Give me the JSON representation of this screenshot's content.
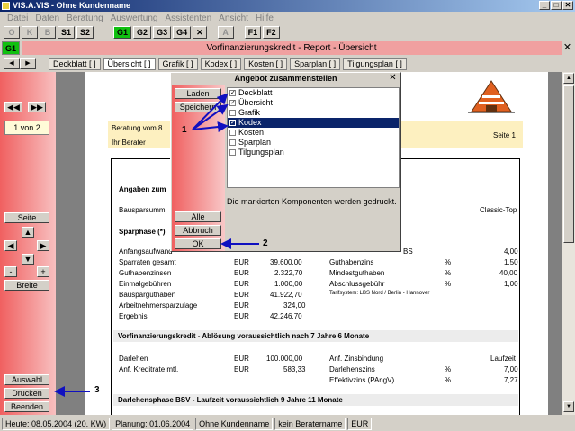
{
  "window": {
    "title": "VIS.A.VIS - Ohne Kundenname"
  },
  "menu": [
    "Datei",
    "Daten",
    "Beratung",
    "Auswertung",
    "Assistenten",
    "Ansicht",
    "Hilfe"
  ],
  "toolbar": {
    "o": "O",
    "k": "K",
    "b": "B",
    "s1": "S1",
    "s2": "S2",
    "g1": "G1",
    "g2": "G2",
    "g3": "G3",
    "g4": "G4",
    "x": "✕",
    "a": "A",
    "f1": "F1",
    "f2": "F2"
  },
  "header": {
    "badge": "G1",
    "title": "Vorfinanzierungskredit - Report - Übersicht",
    "close": "✕"
  },
  "tabs": [
    "Deckblatt [ ]",
    "Übersicht [ ]",
    "Grafik [ ]",
    "Kodex [ ]",
    "Kosten [ ]",
    "Sparplan [ ]",
    "Tilgungsplan [ ]"
  ],
  "left": {
    "page_indicator": "1 von 2",
    "seite": "Seite",
    "minus": "-",
    "plus": "+",
    "breite": "Breite",
    "auswahl": "Auswahl",
    "drucken": "Drucken",
    "beenden": "Beenden"
  },
  "doc": {
    "beratung": "Beratung vom 8.",
    "berater": "Ihr Berater",
    "seite": "Seite  1",
    "angaben": "Angaben zum",
    "bausparsumme": "Bausparsumm",
    "classic": "Classic-Top",
    "sparphase": "Sparphase (*)",
    "sbs": "BS",
    "rows_left": [
      [
        "Anfangsaufwand",
        "",
        ""
      ],
      [
        "Sparraten gesamt",
        "EUR",
        "39.600,00"
      ],
      [
        "Guthabenzinsen",
        "EUR",
        "2.322,70"
      ],
      [
        "Einmalgebühren",
        "EUR",
        "1.000,00"
      ],
      [
        "Bausparguthaben",
        "EUR",
        "41.922,70"
      ],
      [
        "Arbeitnehmersparzulage",
        "EUR",
        "324,00"
      ],
      [
        "Ergebnis",
        "EUR",
        "42.246,70"
      ]
    ],
    "rows_right": [
      [
        "",
        "",
        "4,00"
      ],
      [
        "Guthabenzins",
        "%",
        "1,50"
      ],
      [
        "Mindestguthaben",
        "%",
        "40,00"
      ],
      [
        "Abschlussgebühr",
        "%",
        "1,00"
      ]
    ],
    "tarif": "Tarifsystem: LBS Nord / Berlin - Hannover",
    "vorfin_head": "Vorfinanzierungskredit  -  Ablösung  voraussichtlich nach 7 Jahre 6 Monate",
    "vorfin_left": [
      [
        "Darlehen",
        "EUR",
        "100.000,00"
      ],
      [
        "Anf. Kreditrate mtl.",
        "EUR",
        "583,33"
      ]
    ],
    "vorfin_right": [
      [
        "Anf. Zinsbindung",
        "",
        "Laufzeit"
      ],
      [
        "Darlehenszins",
        "%",
        "7,00"
      ],
      [
        "Effektivzins (PAngV)",
        "%",
        "7,27"
      ]
    ],
    "darlehen_head": "Darlehensphase BSV  -  Laufzeit  voraussichtlich 9 Jahre 11 Monate"
  },
  "dialog": {
    "title": "Angebot zusammenstellen",
    "close": "✕",
    "laden": "Laden",
    "speichern": "Speichern",
    "alle": "Alle",
    "abbruch": "Abbruch",
    "ok": "OK",
    "items": [
      {
        "label": "Deckblatt",
        "check": "✓"
      },
      {
        "label": "Übersicht",
        "check": "✓"
      },
      {
        "label": "Grafik",
        "check": ""
      },
      {
        "label": "Kodex",
        "check": "✓"
      },
      {
        "label": "Kosten",
        "check": ""
      },
      {
        "label": "Sparplan",
        "check": ""
      },
      {
        "label": "Tilgungsplan",
        "check": ""
      }
    ],
    "info": "Die markierten Komponenten werden gedruckt."
  },
  "annotations": {
    "one": "1",
    "two": "2",
    "three": "3"
  },
  "status": [
    "Heute: 08.05.2004 (20. KW)",
    "Planung: 01.06.2004",
    "Ohne Kundenname",
    "kein Beratername",
    "EUR"
  ]
}
